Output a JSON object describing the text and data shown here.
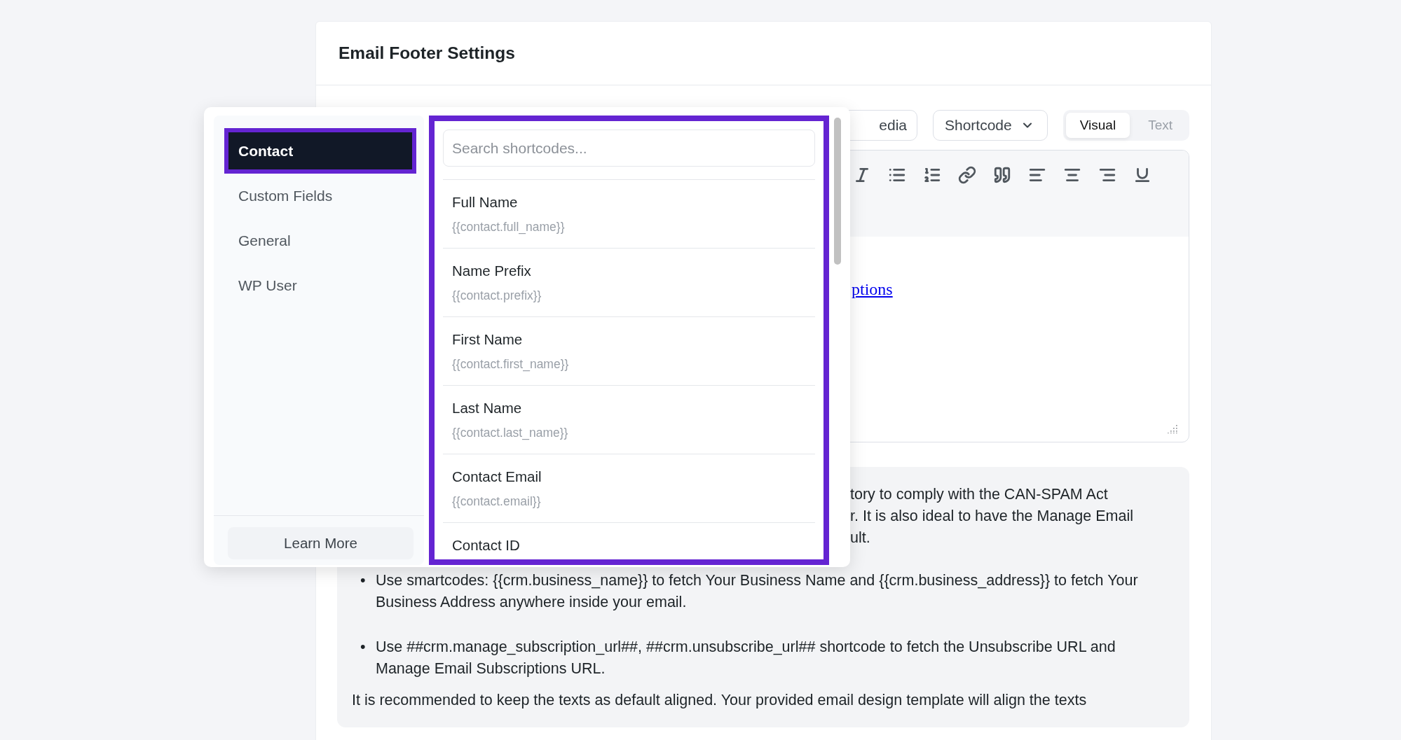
{
  "header": {
    "title": "Email Footer Settings"
  },
  "editor_toolbar": {
    "media_button": "edia",
    "shortcode_button": "Shortcode",
    "modes": [
      {
        "label": "Visual",
        "selected": true
      },
      {
        "label": "Text",
        "selected": false
      }
    ]
  },
  "editor": {
    "link_text": "ptions"
  },
  "info": {
    "partial_lines": [
      "tory to comply with the CAN-SPAM Act",
      "r. It is also ideal to have the Manage Email",
      "ult."
    ],
    "bullets": [
      {
        "marker": "•",
        "text": "Use smartcodes: {{crm.business_name}} to fetch Your Business Name and {{crm.business_address}} to fetch Your Business Address anywhere inside your email."
      },
      {
        "marker": "•",
        "text": "Use ##crm.manage_subscription_url##, ##crm.unsubscribe_url## shortcode to fetch the Unsubscribe URL and Manage Email Subscriptions URL."
      }
    ],
    "note": "It is recommended to keep the texts as default aligned. Your provided email design template will align the texts"
  },
  "shortcode_popup": {
    "groups": [
      {
        "label": "Contact",
        "selected": true
      },
      {
        "label": "Custom Fields",
        "selected": false
      },
      {
        "label": "General",
        "selected": false
      },
      {
        "label": "WP User",
        "selected": false
      }
    ],
    "learn_more": "Learn More",
    "search": {
      "placeholder": "Search shortcodes..."
    },
    "items": [
      {
        "label": "Full Name",
        "code": "{{contact.full_name}}"
      },
      {
        "label": "Name Prefix",
        "code": "{{contact.prefix}}"
      },
      {
        "label": "First Name",
        "code": "{{contact.first_name}}"
      },
      {
        "label": "Last Name",
        "code": "{{contact.last_name}}"
      },
      {
        "label": "Contact Email",
        "code": "{{contact.email}}"
      },
      {
        "label": "Contact ID"
      }
    ]
  }
}
